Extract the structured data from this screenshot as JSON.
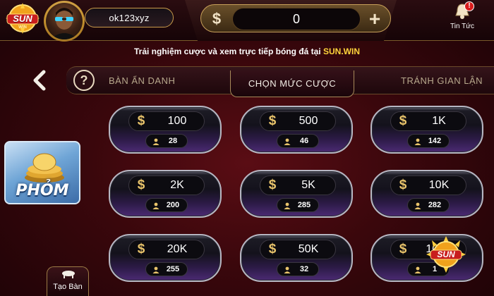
{
  "header": {
    "username": "ok123xyz",
    "balance_symbol": "$",
    "balance": "0",
    "add_symbol": "+",
    "news_label": "Tin Tức",
    "news_badge": "!",
    "logo_text": "SUN",
    "logo_small": "WIN"
  },
  "marquee": {
    "text": "Trải nghiệm cược và xem trực tiếp bóng đá tại",
    "highlight": "SUN.WIN"
  },
  "tabs": {
    "help_symbol": "?",
    "left": "BÀN ẨN DANH",
    "active": "CHỌN MỨC CƯỢC",
    "right": "TRÁNH GIAN LẬN"
  },
  "game": {
    "title": "PHỎM"
  },
  "create_room": {
    "label": "Tạo Bàn"
  },
  "bets": [
    {
      "amount": "100",
      "players": "28"
    },
    {
      "amount": "500",
      "players": "46"
    },
    {
      "amount": "1K",
      "players": "142"
    },
    {
      "amount": "2K",
      "players": "200"
    },
    {
      "amount": "5K",
      "players": "285"
    },
    {
      "amount": "10K",
      "players": "282"
    },
    {
      "amount": "20K",
      "players": "255"
    },
    {
      "amount": "50K",
      "players": "32"
    },
    {
      "amount": "100K",
      "players": "1"
    }
  ],
  "bet_symbol": "$",
  "colors": {
    "accent_gold": "#c9a15a",
    "highlight_yellow": "#ffd43b",
    "badge_red": "#d81b1b"
  },
  "icons": [
    "sun-logo-icon",
    "bell-icon",
    "back-arrow-icon",
    "help-icon",
    "person-icon",
    "table-icon",
    "coins-icon"
  ]
}
